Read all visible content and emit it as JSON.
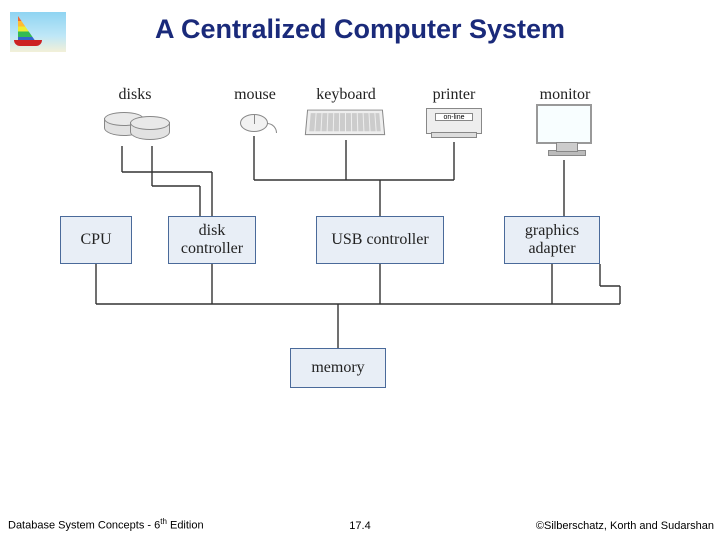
{
  "title": "A Centralized Computer System",
  "devices": {
    "disks": "disks",
    "mouse": "mouse",
    "keyboard": "keyboard",
    "printer": "printer",
    "printer_status": "on-line",
    "monitor": "monitor"
  },
  "nodes": {
    "cpu": "CPU",
    "disk_controller": "disk\ncontroller",
    "usb_controller": "USB controller",
    "graphics_adapter": "graphics\nadapter",
    "memory": "memory"
  },
  "footer": {
    "left_prefix": "Database System Concepts - 6",
    "left_suffix": " Edition",
    "left_sup": "th",
    "center": "17.4",
    "right": "©Silberschatz, Korth and Sudarshan"
  }
}
